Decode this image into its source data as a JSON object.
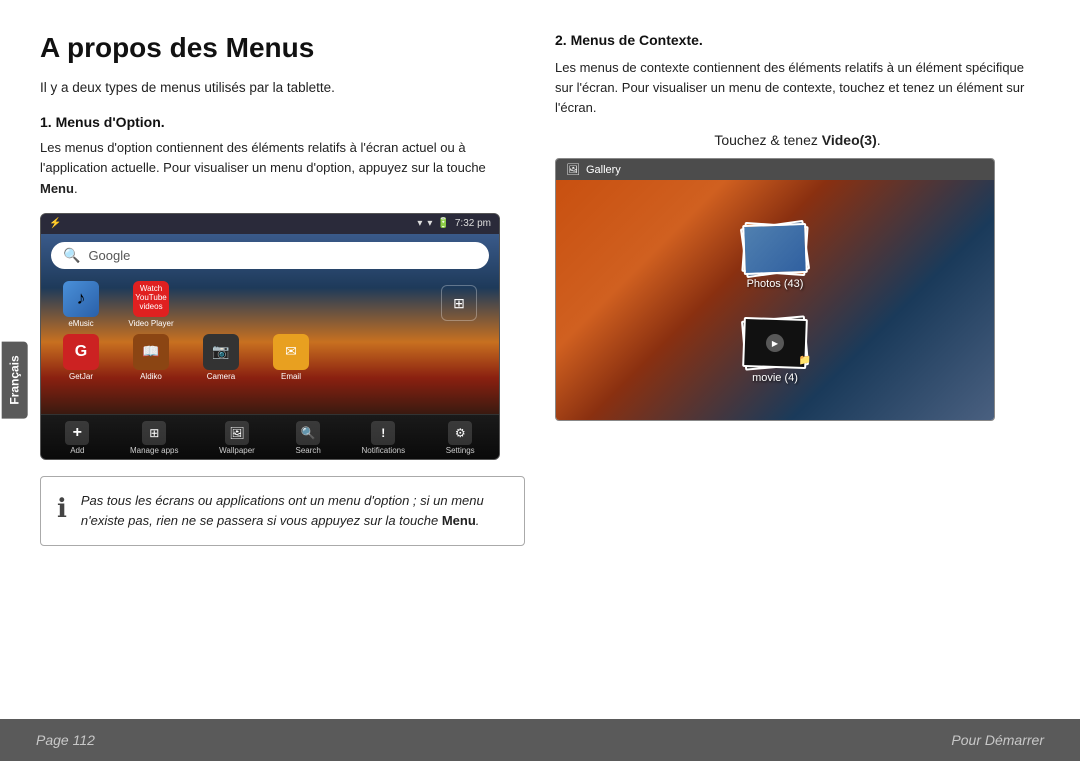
{
  "page": {
    "title": "A propos des Menus",
    "intro": "Il y a deux types de menus utilisés par la tablette.",
    "section1": {
      "heading": "1.   Menus d'Option.",
      "body": "Les menus d'option contiennent des éléments relatifs à l'écran actuel ou à l'application actuelle. Pour visualiser un menu d'option, appuyez sur la touche ",
      "body_bold": "Menu",
      "body_end": "."
    },
    "section2": {
      "heading": "2. Menus de Contexte.",
      "body": "Les menus de contexte contiennent des éléments relatifs à un élément spécifique sur l'écran. Pour visualiser un menu de contexte, touchez et tenez un élément sur l'écran."
    },
    "touch_instruction": "Touchez & tenez ",
    "touch_instruction_bold": "Video(3)",
    "touch_instruction_end": ".",
    "info_text1": "Pas tous les écrans ou applications ont un menu d'option ; si un menu n'existe pas, rien ne se passera si vous appuyez sur la touche ",
    "info_bold": "Menu",
    "info_text2": ".",
    "side_tab": "Français"
  },
  "android_mockup": {
    "status_time": "7:32 pm",
    "search_placeholder": "Google",
    "apps_row1": [
      {
        "label": "eMusic",
        "icon": "♪"
      },
      {
        "label": "Video Player",
        "icon": "▶"
      }
    ],
    "apps_row2": [
      {
        "label": "GetJar",
        "icon": "G"
      },
      {
        "label": "Aldiko",
        "icon": "📚"
      },
      {
        "label": "Camera",
        "icon": "📷"
      },
      {
        "label": "Email",
        "icon": "✉"
      }
    ],
    "bottom_items": [
      {
        "label": "Add",
        "icon": "+"
      },
      {
        "label": "Manage apps",
        "icon": "⊞"
      },
      {
        "label": "Wallpaper",
        "icon": "🖼"
      },
      {
        "label": "Search",
        "icon": "🔍"
      },
      {
        "label": "Notifications",
        "icon": "!"
      },
      {
        "label": "Settings",
        "icon": "⚙"
      }
    ]
  },
  "gallery_mockup": {
    "title": "Gallery",
    "photos_label": "Photos (43)",
    "movie_label": "movie  (4)"
  },
  "footer": {
    "page_label": "Page 112",
    "nav_label": "Pour Démarrer"
  }
}
